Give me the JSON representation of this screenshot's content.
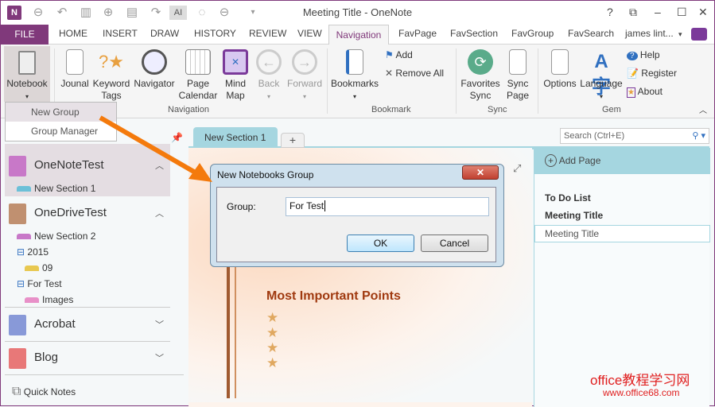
{
  "window": {
    "title": "Meeting Title - OneNote",
    "controls": [
      "?",
      "⧉",
      "–",
      "☐",
      "✕"
    ]
  },
  "ribbon_tabs": [
    "FILE",
    "HOME",
    "INSERT",
    "DRAW",
    "HISTORY",
    "REVIEW",
    "VIEW",
    "Navigation",
    "FavPage",
    "FavSection",
    "FavGroup",
    "FavSearch"
  ],
  "user": "james lint...",
  "ribbon": {
    "notebook": "Notebook",
    "journal": "Jounal",
    "keyword_tags": [
      "Keyword",
      "Tags"
    ],
    "navigator": "Navigator",
    "page_calendar": [
      "Page",
      "Calendar"
    ],
    "mind_map": [
      "Mind",
      "Map"
    ],
    "back": "Back",
    "forward": "Forward",
    "bookmarks": "Bookmarks",
    "add": "Add",
    "remove_all": "Remove All",
    "favorites_sync": [
      "Favorites",
      "Sync"
    ],
    "sync_page": [
      "Sync",
      "Page"
    ],
    "options": "Options",
    "language": "Language",
    "help": "Help",
    "register": "Register",
    "about": "About",
    "groups": [
      "Navigation",
      "Bookmark",
      "Sync",
      "Gem"
    ]
  },
  "notebook_menu": [
    "New Group",
    "Group Manager"
  ],
  "notebooks": [
    {
      "name": "OneNoteTest",
      "color": "#c878c8"
    },
    {
      "name": "OneDriveTest",
      "color": "#c09070"
    },
    {
      "name": "Acrobat",
      "color": "#8899d8"
    },
    {
      "name": "Blog",
      "color": "#e87878"
    }
  ],
  "sections": [
    "New Section 1",
    "New Section 2",
    "2015",
    "09",
    "For Test",
    "Images"
  ],
  "quick_notes": "Quick Notes",
  "section_tab": "New Section 1",
  "add_tab": "+",
  "search": {
    "placeholder": "Search (Ctrl+E)"
  },
  "add_page": "Add Page",
  "pages": [
    "To Do List",
    "Meeting Title",
    "Meeting Title"
  ],
  "page_content": {
    "heading": "Most Important Points",
    "stars": [
      "★",
      "★",
      "★",
      "★"
    ]
  },
  "dialog": {
    "title": "New Notebooks Group",
    "label": "Group:",
    "value": "For Test",
    "ok": "OK",
    "cancel": "Cancel",
    "close": "✕"
  },
  "watermark": {
    "line1": "office教程学习网",
    "line2": "www.office68.com"
  }
}
